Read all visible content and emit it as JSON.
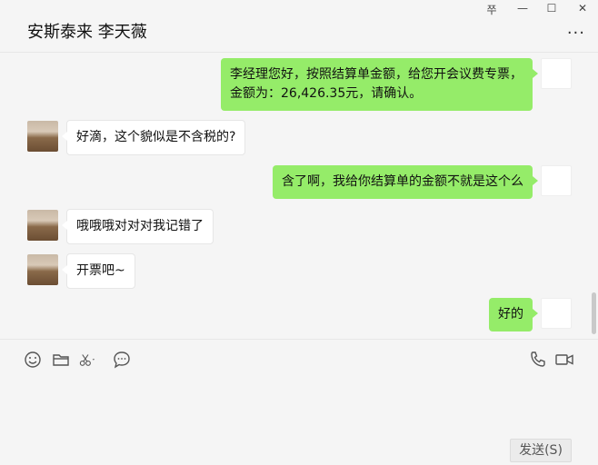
{
  "window": {
    "pin_label": "쭈",
    "minimize_label": "—",
    "maximize_label": "☐",
    "close_label": "✕"
  },
  "header": {
    "title": "安斯泰来 李天薇",
    "more_label": "···"
  },
  "messages": [
    {
      "side": "right",
      "text_line1": "李经理您好，按照结算单金额，给您开会议费专票，",
      "text_line2": "金额为：26,426.35元，请确认。"
    },
    {
      "side": "left",
      "text": "好滴，这个貌似是不含税的?"
    },
    {
      "side": "right",
      "text": "含了啊，我给你结算单的金额不就是这个么"
    },
    {
      "side": "left",
      "text": "哦哦哦对对对我记错了"
    },
    {
      "side": "left",
      "text": "开票吧~"
    },
    {
      "side": "right",
      "text": "好的"
    }
  ],
  "toolbar": {
    "emoji": "emoji-icon",
    "folder": "folder-icon",
    "scissors": "scissors-icon",
    "chat": "chat-bubble-icon",
    "phone": "phone-icon",
    "video": "video-icon"
  },
  "send": {
    "label": "发送(S)"
  },
  "colors": {
    "self_bubble": "#95ec69",
    "other_bubble": "#ffffff",
    "background": "#f5f5f5"
  }
}
